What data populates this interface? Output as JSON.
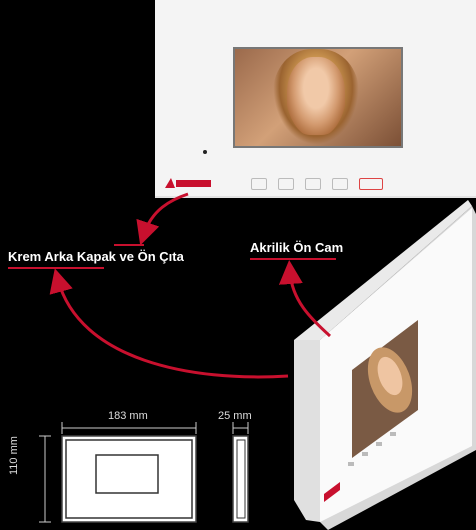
{
  "labels": {
    "back_cover": "Krem Arka Kapak ve Ön Çıta",
    "front_glass": "Akrilik Ön Cam"
  },
  "dimensions": {
    "width": "183 mm",
    "depth": "25 mm",
    "height": "110 mm"
  },
  "colors": {
    "accent": "#c8102e",
    "background": "#000000",
    "device": "#f4f4f4"
  }
}
